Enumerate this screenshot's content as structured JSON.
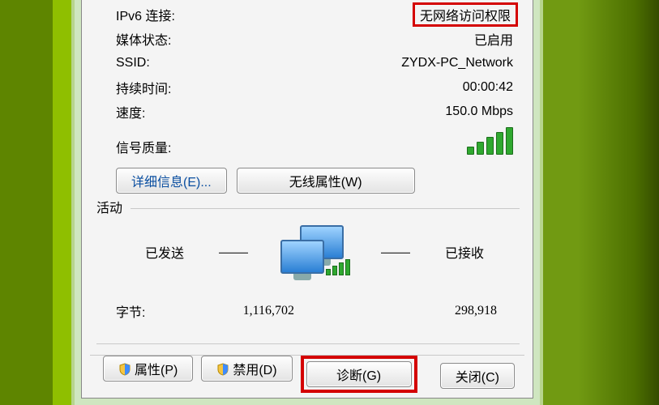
{
  "info": {
    "ipv6_label": "IPv6 连接:",
    "ipv6_value": "无网络访问权限",
    "media_label": "媒体状态:",
    "media_value": "已启用",
    "ssid_label": "SSID:",
    "ssid_value": "ZYDX-PC_Network",
    "duration_label": "持续时间:",
    "duration_value": "00:00:42",
    "speed_label": "速度:",
    "speed_value": "150.0 Mbps",
    "signal_label": "信号质量:"
  },
  "buttons": {
    "details": "详细信息(E)...",
    "wireless_props": "无线属性(W)",
    "properties": "属性(P)",
    "disable": "禁用(D)",
    "diagnose": "诊断(G)",
    "close": "关闭(C)"
  },
  "activity": {
    "section": "活动",
    "sent": "已发送",
    "received": "已接收",
    "bytes_label": "字节:",
    "bytes_sent": "1,116,702",
    "bytes_received": "298,918"
  }
}
